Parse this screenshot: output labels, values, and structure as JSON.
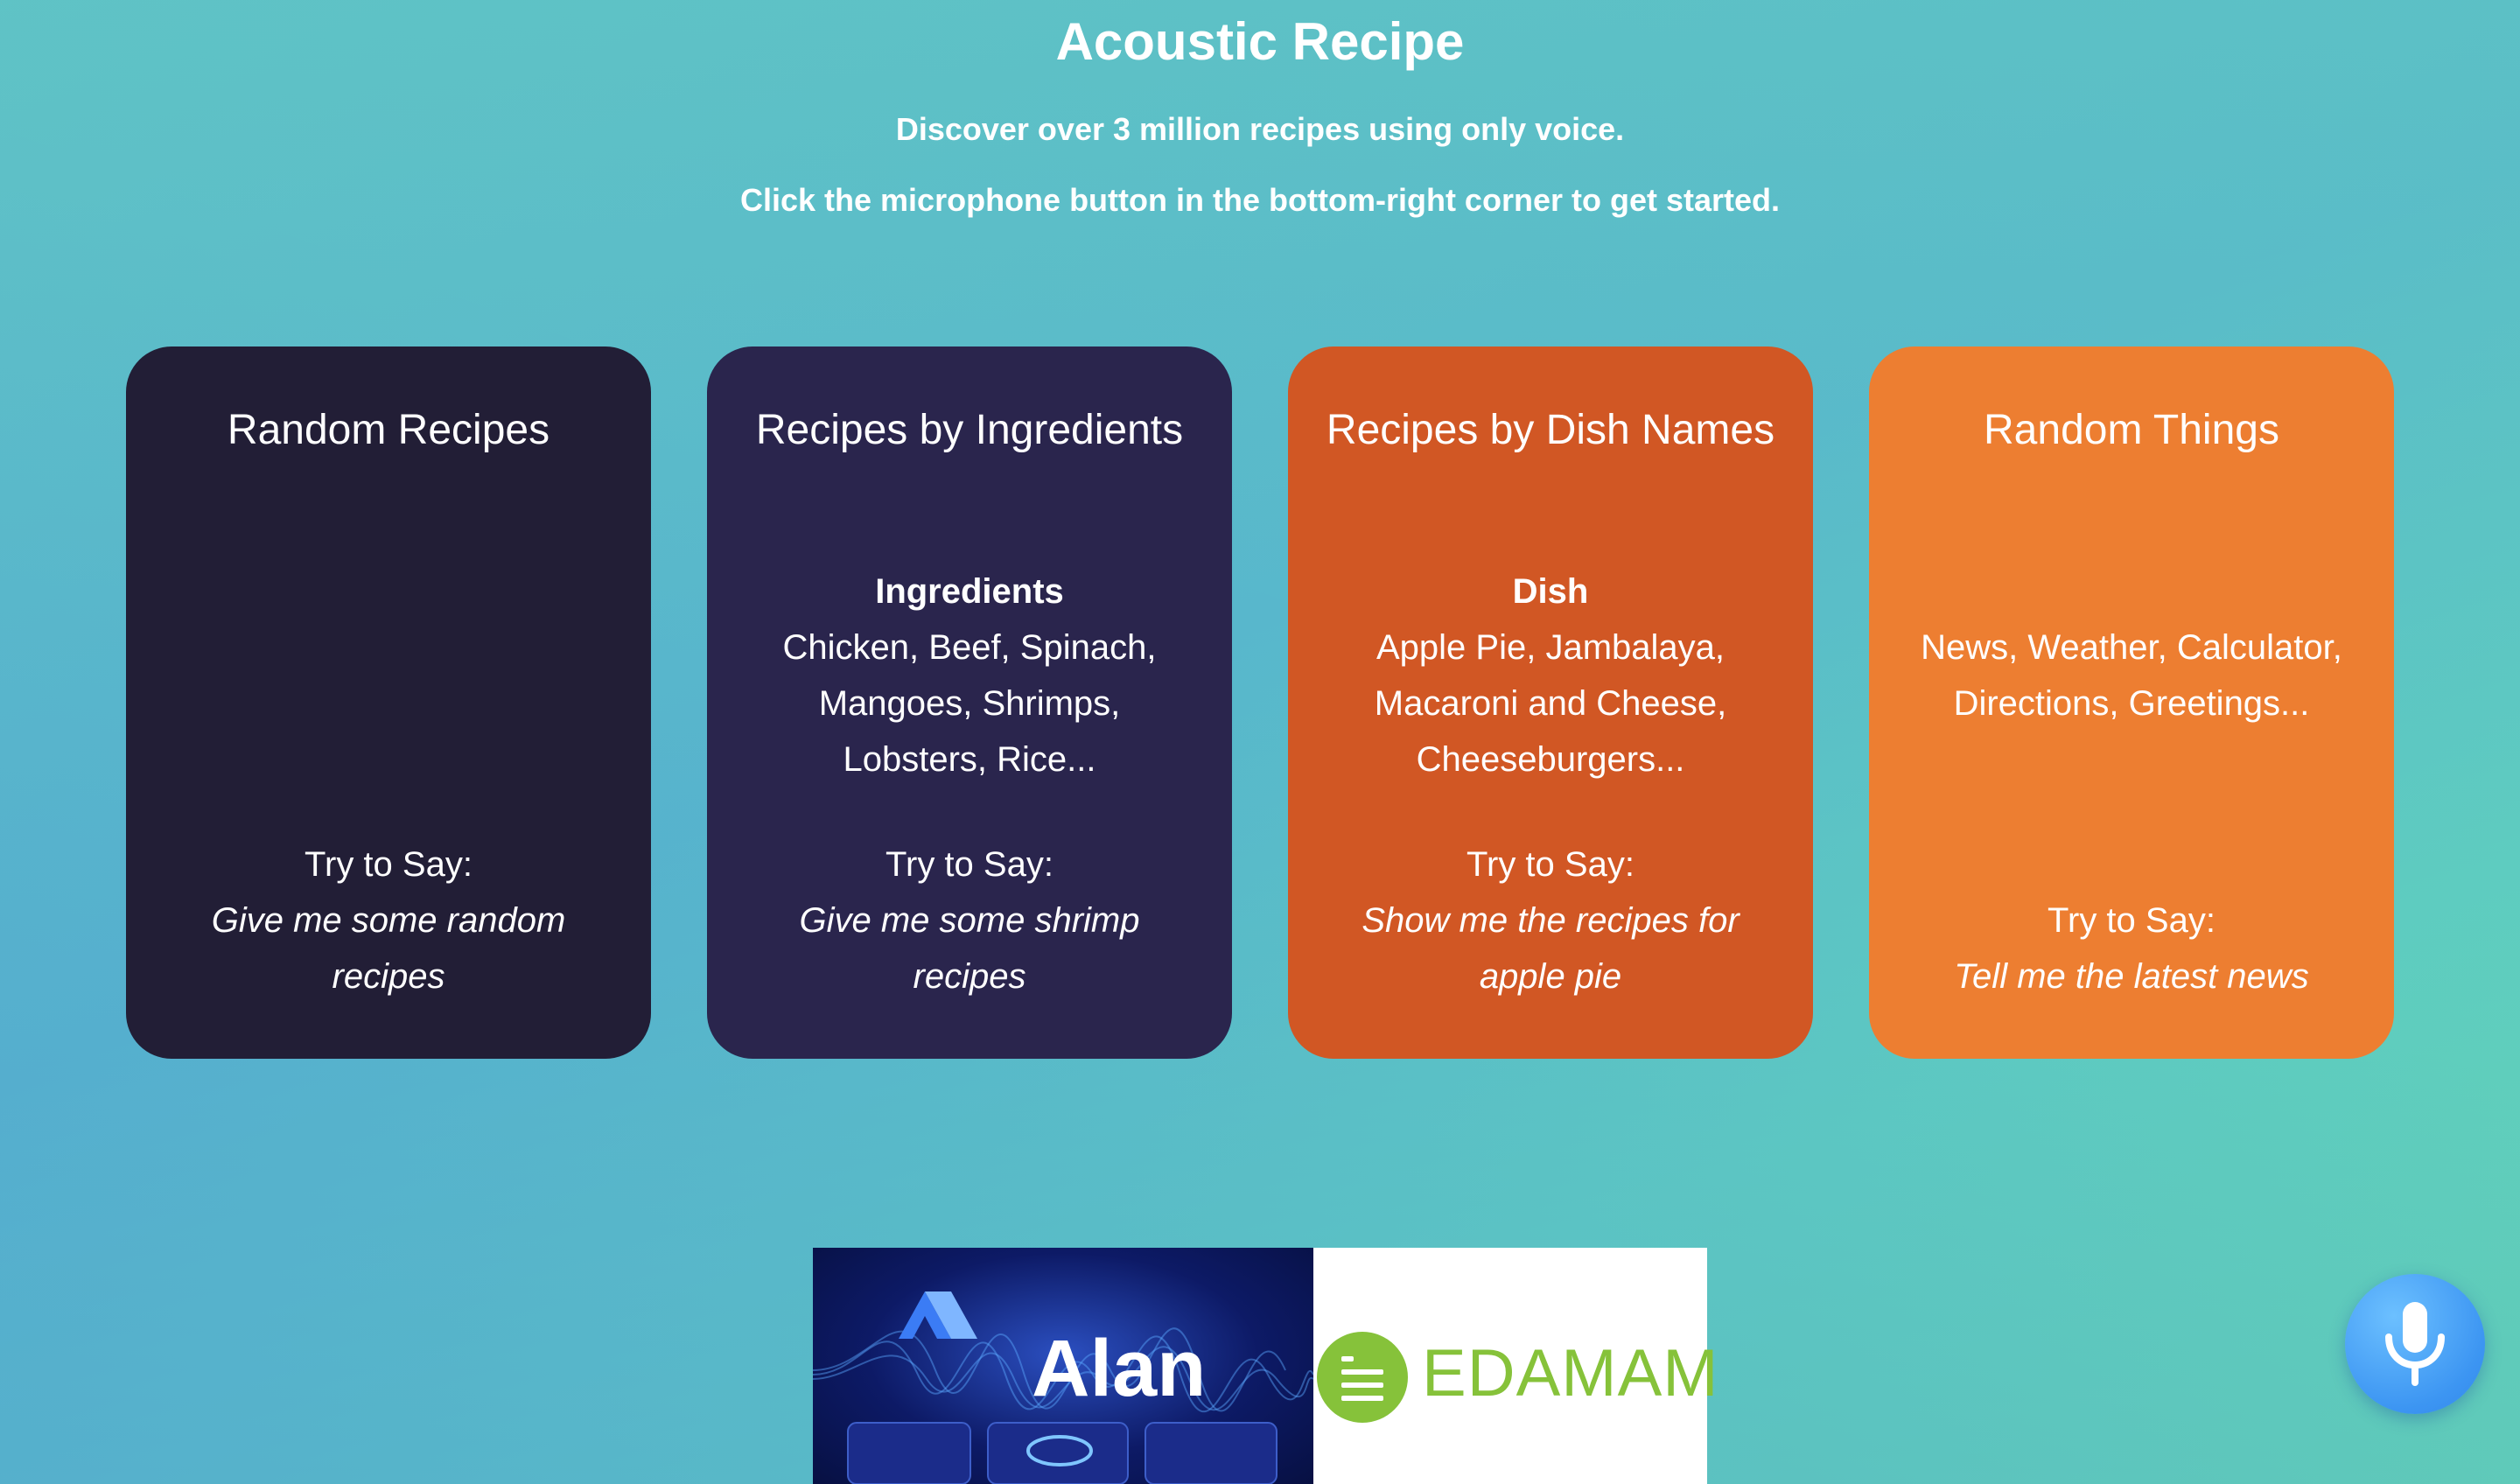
{
  "header": {
    "title": "Acoustic Recipe",
    "subtitle_1": "Discover over 3 million recipes using only voice.",
    "subtitle_2": "Click the microphone button in the bottom-right corner to get started."
  },
  "cards": [
    {
      "title": "Random Recipes",
      "heading": "",
      "items": "",
      "try_label": "Try to Say:",
      "try_phrase": "Give me some random recipes",
      "color": "#221e36"
    },
    {
      "title": "Recipes by Ingredients",
      "heading": "Ingredients",
      "items": "Chicken, Beef, Spinach, Mangoes, Shrimps, Lobsters, Rice...",
      "try_label": "Try to Say:",
      "try_phrase": "Give me some shrimp recipes",
      "color": "#2a254d"
    },
    {
      "title": "Recipes by Dish Names",
      "heading": "Dish",
      "items": "Apple Pie, Jambalaya, Macaroni and Cheese, Cheeseburgers...",
      "try_label": "Try to Say:",
      "try_phrase": "Show me the recipes for apple pie",
      "color": "#d15724"
    },
    {
      "title": "Random Things",
      "heading": "",
      "items": "News, Weather, Calculator, Directions, Greetings...",
      "try_label": "Try to Say:",
      "try_phrase": "Tell me the latest news",
      "color": "#ed7e31"
    }
  ],
  "logos": {
    "alan": "Alan",
    "edamam": "EDAMAM"
  },
  "mic_button": {
    "icon": "microphone-icon",
    "color": "#3c95f2"
  }
}
